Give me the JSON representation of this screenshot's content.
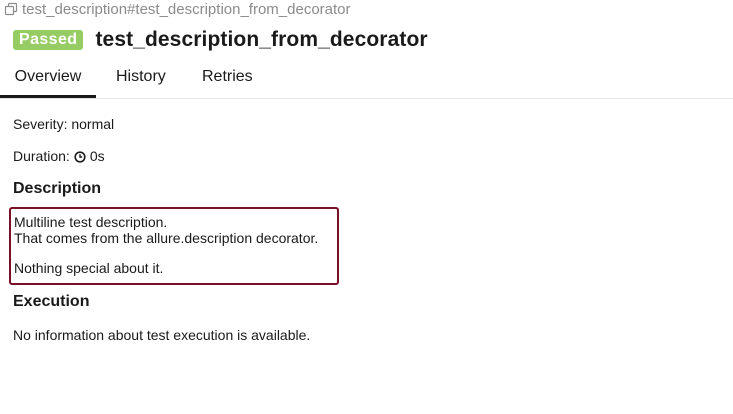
{
  "breadcrumb": {
    "icon": "copy-icon",
    "text": "test_description#test_description_from_decorator"
  },
  "header": {
    "status": "Passed",
    "status_color": "#97cc64",
    "title": "test_description_from_decorator"
  },
  "tabs": [
    {
      "label": "Overview",
      "active": true
    },
    {
      "label": "History",
      "active": false
    },
    {
      "label": "Retries",
      "active": false
    }
  ],
  "details": {
    "severity": "Severity: normal",
    "duration_label": "Duration:",
    "duration_icon": "clock-icon",
    "duration_value": "0s"
  },
  "description": {
    "heading": "Description",
    "lines": [
      "Multiline test description.",
      "That comes from the allure.description decorator.",
      "Nothing special about it."
    ],
    "highlight_color": "#7a1028"
  },
  "execution": {
    "heading": "Execution",
    "text": "No information about test execution is available."
  }
}
